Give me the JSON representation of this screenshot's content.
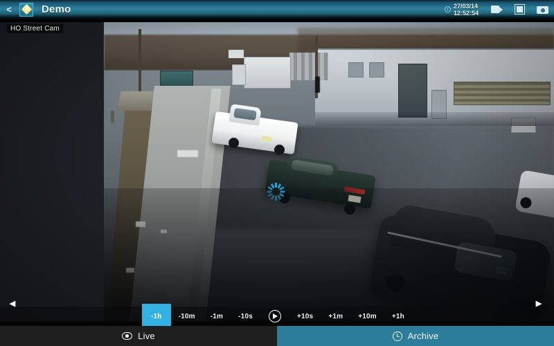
{
  "header": {
    "back_label": "<",
    "logo_icon": "diamond-logo-icon",
    "title": "Demo",
    "clock_icon": "clock-icon",
    "date": "27/03/14",
    "time": "12:52:54",
    "buttons": [
      {
        "name": "record-video-button",
        "icon": "video-camera-icon"
      },
      {
        "name": "stop-button",
        "icon": "square-frame-icon"
      },
      {
        "name": "snapshot-button",
        "icon": "photo-camera-icon"
      }
    ],
    "accent_color": "#2d7f9e"
  },
  "video": {
    "camera_label": "HO Street Cam",
    "spinner_icon": "loading-spinner-icon",
    "nav_prev_icon": "chevron-left-icon",
    "nav_next_icon": "chevron-right-icon",
    "nav_prev_label": "◀",
    "nav_next_label": "▶"
  },
  "playback": {
    "buttons": [
      {
        "label": "-1h",
        "active": true
      },
      {
        "label": "-10m",
        "active": false
      },
      {
        "label": "-1m",
        "active": false
      },
      {
        "label": "-10s",
        "active": false
      }
    ],
    "play_icon": "play-button-icon",
    "buttons_after": [
      {
        "label": "+10s",
        "active": false
      },
      {
        "label": "+1m",
        "active": false
      },
      {
        "label": "+10m",
        "active": false
      },
      {
        "label": "+1h",
        "active": false
      }
    ],
    "active_color": "#33b1e3"
  },
  "tabs": [
    {
      "label": "Live",
      "icon": "eye-icon",
      "selected": false,
      "color": "#1e1e1e"
    },
    {
      "label": "Archive",
      "icon": "clock-icon",
      "selected": true,
      "color": "#2c7d9c"
    }
  ]
}
